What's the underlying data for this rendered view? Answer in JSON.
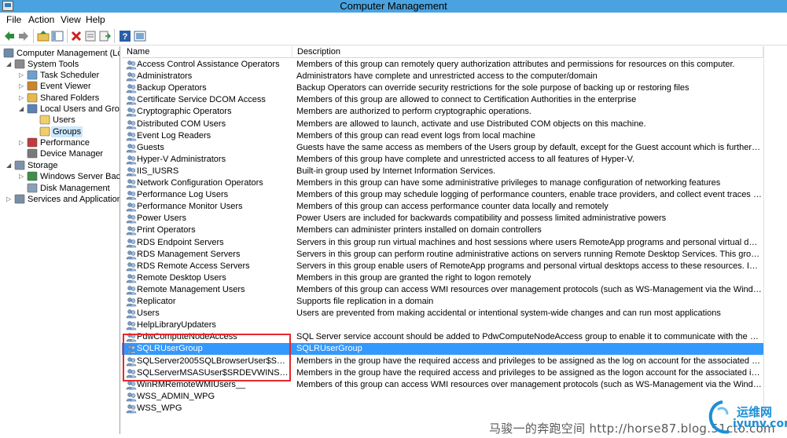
{
  "window": {
    "title": "Computer Management"
  },
  "menu": [
    "File",
    "Action",
    "View",
    "Help"
  ],
  "toolbar": {
    "buttons": [
      "back-icon",
      "forward-icon",
      "up-folder-icon",
      "show-hide-tree-icon",
      "delete-icon",
      "properties-icon",
      "export-icon",
      "help-icon",
      "console-icon"
    ]
  },
  "tree": [
    {
      "label": "Computer Management (Local",
      "level": 0,
      "expander": "",
      "icon": "computer-icon"
    },
    {
      "label": "System Tools",
      "level": 1,
      "expander": "◢",
      "icon": "tools-icon"
    },
    {
      "label": "Task Scheduler",
      "level": 2,
      "expander": "▷",
      "icon": "clock-icon"
    },
    {
      "label": "Event Viewer",
      "level": 2,
      "expander": "▷",
      "icon": "event-icon"
    },
    {
      "label": "Shared Folders",
      "level": 2,
      "expander": "▷",
      "icon": "share-icon"
    },
    {
      "label": "Local Users and Groups",
      "level": 2,
      "expander": "◢",
      "icon": "users-icon"
    },
    {
      "label": "Users",
      "level": 3,
      "expander": "",
      "icon": "folder-icon"
    },
    {
      "label": "Groups",
      "level": 3,
      "expander": "",
      "icon": "folder-icon"
    },
    {
      "label": "Performance",
      "level": 2,
      "expander": "▷",
      "icon": "perf-icon"
    },
    {
      "label": "Device Manager",
      "level": 2,
      "expander": "",
      "icon": "device-icon"
    },
    {
      "label": "Storage",
      "level": 1,
      "expander": "◢",
      "icon": "storage-icon"
    },
    {
      "label": "Windows Server Backup",
      "level": 2,
      "expander": "▷",
      "icon": "backup-icon"
    },
    {
      "label": "Disk Management",
      "level": 2,
      "expander": "",
      "icon": "disk-icon"
    },
    {
      "label": "Services and Applications",
      "level": 1,
      "expander": "▷",
      "icon": "services-icon"
    }
  ],
  "list": {
    "columns": [
      "Name",
      "Description"
    ],
    "rows": [
      {
        "name": "Access Control Assistance Operators",
        "desc": "Members of this group can remotely query authorization attributes and permissions for resources on this computer."
      },
      {
        "name": "Administrators",
        "desc": "Administrators have complete and unrestricted access to the computer/domain"
      },
      {
        "name": "Backup Operators",
        "desc": "Backup Operators can override security restrictions for the sole purpose of backing up or restoring files"
      },
      {
        "name": "Certificate Service DCOM Access",
        "desc": "Members of this group are allowed to connect to Certification Authorities in the enterprise"
      },
      {
        "name": "Cryptographic Operators",
        "desc": "Members are authorized to perform cryptographic operations."
      },
      {
        "name": "Distributed COM Users",
        "desc": "Members are allowed to launch, activate and use Distributed COM objects on this machine."
      },
      {
        "name": "Event Log Readers",
        "desc": "Members of this group can read event logs from local machine"
      },
      {
        "name": "Guests",
        "desc": "Guests have the same access as members of the Users group by default, except for the Guest account which is further restricted"
      },
      {
        "name": "Hyper-V Administrators",
        "desc": "Members of this group have complete and unrestricted access to all features of Hyper-V."
      },
      {
        "name": "IIS_IUSRS",
        "desc": "Built-in group used by Internet Information Services."
      },
      {
        "name": "Network Configuration Operators",
        "desc": "Members in this group can have some administrative privileges to manage configuration of networking features"
      },
      {
        "name": "Performance Log Users",
        "desc": "Members of this group may schedule logging of performance counters, enable trace providers, and collect event traces both locally and vi..."
      },
      {
        "name": "Performance Monitor Users",
        "desc": "Members of this group can access performance counter data locally and remotely"
      },
      {
        "name": "Power Users",
        "desc": "Power Users are included for backwards compatibility and possess limited administrative powers"
      },
      {
        "name": "Print Operators",
        "desc": "Members can administer printers installed on domain controllers"
      },
      {
        "name": "RDS Endpoint Servers",
        "desc": "Servers in this group run virtual machines and host sessions where users RemoteApp programs and personal virtual desktops run. This gro..."
      },
      {
        "name": "RDS Management Servers",
        "desc": "Servers in this group can perform routine administrative actions on servers running Remote Desktop Services. This group needs to be popu..."
      },
      {
        "name": "RDS Remote Access Servers",
        "desc": "Servers in this group enable users of RemoteApp programs and personal virtual desktops access to these resources. In Internet-facing depl..."
      },
      {
        "name": "Remote Desktop Users",
        "desc": "Members in this group are granted the right to logon remotely"
      },
      {
        "name": "Remote Management Users",
        "desc": "Members of this group can access WMI resources over management protocols (such as WS-Management via the Windows Remote Mana..."
      },
      {
        "name": "Replicator",
        "desc": "Supports file replication in a domain"
      },
      {
        "name": "Users",
        "desc": "Users are prevented from making accidental or intentional system-wide changes and can run most applications"
      },
      {
        "name": "HelpLibraryUpdaters",
        "desc": ""
      },
      {
        "name": "PdwComputeNodeAccess",
        "desc": "SQL Server service account should be added to PdwComputeNodeAccess group to enable it to communicate with the PolyBase Data Mov..."
      },
      {
        "name": "SQLRUserGroup",
        "desc": "SQLRUserGroup",
        "selected": true
      },
      {
        "name": "SQLServer2005SQLBrowserUser$SRDEVWINS...",
        "desc": "Members in the group have the required access and privileges to be assigned as the log on account for the associated instance of SQL Serv..."
      },
      {
        "name": "SQLServerMSASUser$SRDEVWINSQL05$MSS...",
        "desc": "Members in the group have the required access and privileges to be assigned as the logon account for the associated instance of SQL Serv..."
      },
      {
        "name": "WinRMRemoteWMIUsers__",
        "desc": "Members of this group can access WMI resources over management protocols (such as WS-Management via the Windows Remote Mana..."
      },
      {
        "name": "WSS_ADMIN_WPG",
        "desc": ""
      },
      {
        "name": "WSS_WPG",
        "desc": ""
      }
    ]
  },
  "watermark": {
    "text": "马骏一的奔跑空间 http://horse87.blog.51cto.com"
  },
  "logo": {
    "cn": "运维网",
    "en": "iyunv.com"
  },
  "colors": {
    "titlebar": "#4aa3e0",
    "selection": "#3399ff",
    "highlight_box": "#e8282b"
  }
}
